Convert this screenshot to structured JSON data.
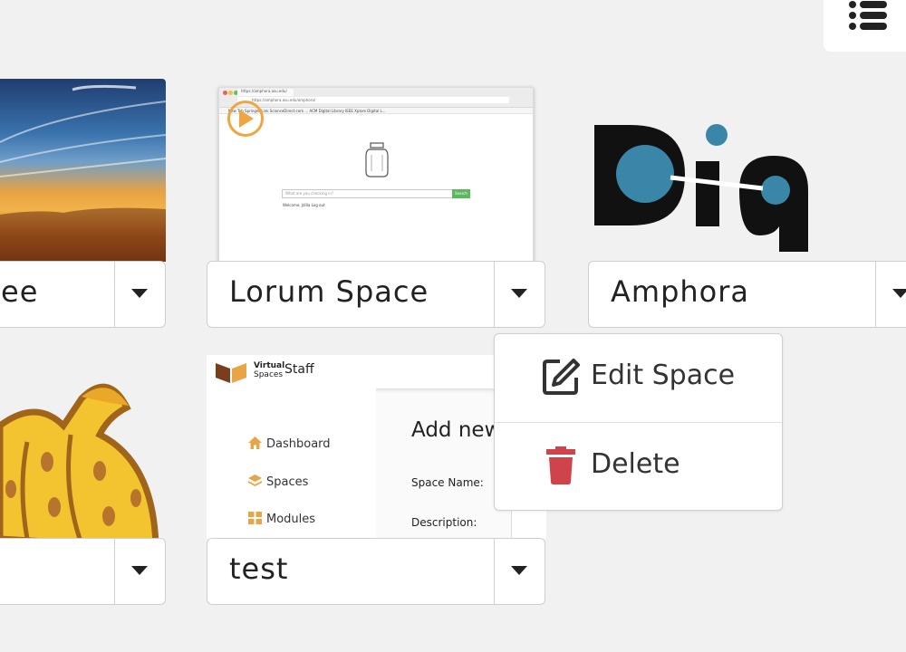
{
  "spaces": [
    {
      "name": "ee"
    },
    {
      "name": "Lorum Space"
    },
    {
      "name": "Amphora"
    },
    {
      "name": ""
    },
    {
      "name": "test"
    }
  ],
  "lorum_thumb": {
    "tab_title": "https://amphora.asu.edu/",
    "url": "https://amphora.asu.edu/amphora/",
    "bookmarks": "New Tab    Springer Link    ScienceDirect.com ...    ACM Digital Library    IEEE Xplore Digital L...",
    "search_placeholder": "What are you checking in?",
    "search_button": "Search",
    "welcome": "Welcome, Jdilla    Log out"
  },
  "amphora_logo": {
    "text": "Dig",
    "accent_color": "#3a86a8"
  },
  "staff_thumb": {
    "brand_line1": "Virtual",
    "brand_line2": "Spaces",
    "title": "Staff",
    "nav": [
      {
        "label": "Dashboard",
        "icon": "home-icon"
      },
      {
        "label": "Spaces",
        "icon": "layers-icon"
      },
      {
        "label": "Modules",
        "icon": "grid-icon"
      }
    ],
    "heading": "Add new",
    "fields": [
      "Space Name:",
      "Description:"
    ]
  },
  "context_menu": {
    "edit_label": "Edit Space",
    "delete_label": "Delete",
    "delete_color": "#d0434b"
  },
  "colors": {
    "play_accent": "#f0a640",
    "search_green": "#5cb85c"
  }
}
